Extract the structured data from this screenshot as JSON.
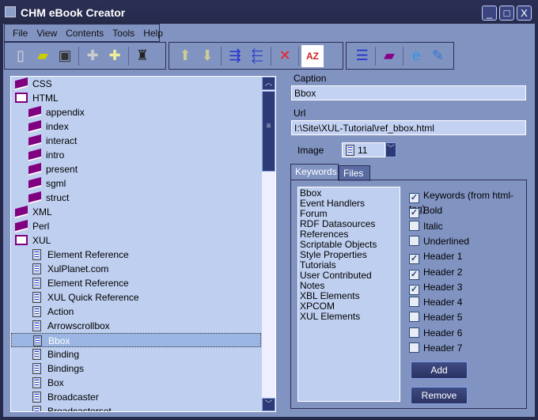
{
  "window": {
    "title": "CHM eBook Creator",
    "min": "_",
    "max": "□",
    "close": "X"
  },
  "menu": [
    "File",
    "View",
    "Contents",
    "Tools",
    "Help"
  ],
  "toolbar": [
    [
      "new-icon",
      "open-icon",
      "save-icon"
    ],
    [
      "add-page-icon",
      "add-folder-icon"
    ],
    [
      "compile-icon"
    ],
    [
      "move-up-icon",
      "move-down-icon"
    ],
    [
      "indent-icon",
      "outdent-icon"
    ],
    [
      "delete-icon"
    ],
    [
      "sort-icon"
    ],
    [
      "properties-icon"
    ],
    [
      "book-settings-icon"
    ],
    [
      "browser-icon"
    ],
    [
      "edit-icon"
    ]
  ],
  "tree": [
    {
      "label": "CSS",
      "icon": "book",
      "level": 0
    },
    {
      "label": "HTML",
      "icon": "open-book",
      "level": 0
    },
    {
      "label": "appendix",
      "icon": "book",
      "level": 1
    },
    {
      "label": "index",
      "icon": "book",
      "level": 1
    },
    {
      "label": "interact",
      "icon": "book",
      "level": 1
    },
    {
      "label": "intro",
      "icon": "book",
      "level": 1
    },
    {
      "label": "present",
      "icon": "book",
      "level": 1
    },
    {
      "label": "sgml",
      "icon": "book",
      "level": 1
    },
    {
      "label": "struct",
      "icon": "book",
      "level": 1
    },
    {
      "label": "XML",
      "icon": "book",
      "level": 0
    },
    {
      "label": "Perl",
      "icon": "book",
      "level": 0
    },
    {
      "label": "XUL",
      "icon": "open-book",
      "level": 0
    },
    {
      "label": "Element Reference",
      "icon": "page",
      "level": 1
    },
    {
      "label": "XulPlanet.com",
      "icon": "page",
      "level": 1
    },
    {
      "label": "Element Reference",
      "icon": "page",
      "level": 1
    },
    {
      "label": "XUL Quick Reference",
      "icon": "page",
      "level": 1
    },
    {
      "label": "Action",
      "icon": "page",
      "level": 1
    },
    {
      "label": "Arrowscrollbox",
      "icon": "page",
      "level": 1
    },
    {
      "label": "Bbox",
      "icon": "page",
      "level": 1,
      "selected": true
    },
    {
      "label": "Binding",
      "icon": "page",
      "level": 1
    },
    {
      "label": "Bindings",
      "icon": "page",
      "level": 1
    },
    {
      "label": "Box",
      "icon": "page",
      "level": 1
    },
    {
      "label": "Broadcaster",
      "icon": "page",
      "level": 1
    },
    {
      "label": "Broadcasterset",
      "icon": "page",
      "level": 1
    }
  ],
  "form": {
    "caption_label": "Caption",
    "caption_value": "Bbox",
    "url_label": "Url",
    "url_value": "I:\\Site\\XUL-Tutorial\\ref_bbox.html",
    "image_label": "Image",
    "image_value": "11"
  },
  "tabs": [
    "Keywords",
    "Files"
  ],
  "keywords": [
    "Bbox",
    "Event Handlers",
    "Forum",
    "RDF Datasources",
    "References",
    "Scriptable Objects",
    "Style Properties",
    "Tutorials",
    "User Contributed Notes",
    "XBL Elements",
    "XPCOM",
    "XUL Elements"
  ],
  "options": [
    {
      "label": "Keywords (from html-tag)",
      "checked": true
    },
    {
      "label": "Bold",
      "checked": true
    },
    {
      "label": "Italic",
      "checked": false
    },
    {
      "label": "Underlined",
      "checked": false
    },
    {
      "label": "Header 1",
      "checked": true
    },
    {
      "label": "Header 2",
      "checked": true
    },
    {
      "label": "Header 3",
      "checked": true
    },
    {
      "label": "Header 4",
      "checked": false
    },
    {
      "label": "Header 5",
      "checked": false
    },
    {
      "label": "Header 6",
      "checked": false
    },
    {
      "label": "Header 7",
      "checked": false
    }
  ],
  "buttons": {
    "add": "Add",
    "remove": "Remove"
  }
}
